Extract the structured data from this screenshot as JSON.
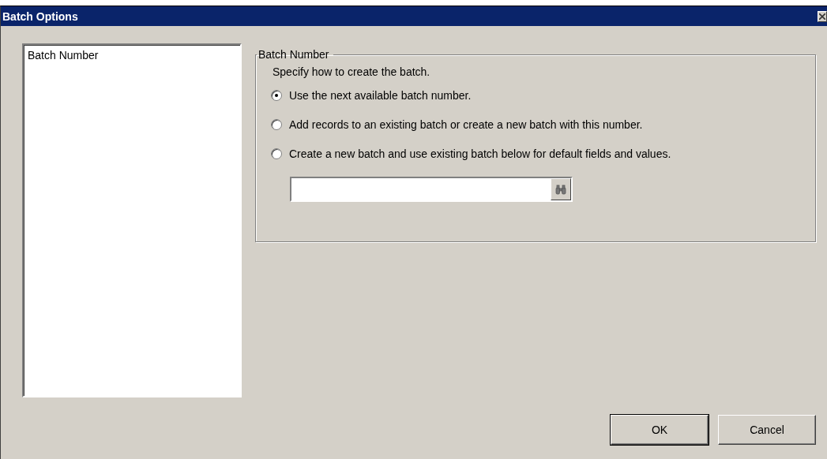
{
  "window": {
    "title": "Batch Options"
  },
  "sidebar": {
    "items": [
      {
        "label": "Batch Number",
        "selected": false
      }
    ]
  },
  "group": {
    "title": "Batch Number",
    "instruction": "Specify how to create the batch.",
    "options": [
      {
        "label": "Use the next available batch number.",
        "selected": true
      },
      {
        "label": "Add records to an existing batch or create a new batch with this number.",
        "selected": false
      },
      {
        "label": "Create a new batch and use existing batch below for default fields and values.",
        "selected": false
      }
    ]
  },
  "buttons": [
    {
      "label": "OK",
      "default": true
    },
    {
      "label": "Cancel",
      "default": false
    }
  ]
}
